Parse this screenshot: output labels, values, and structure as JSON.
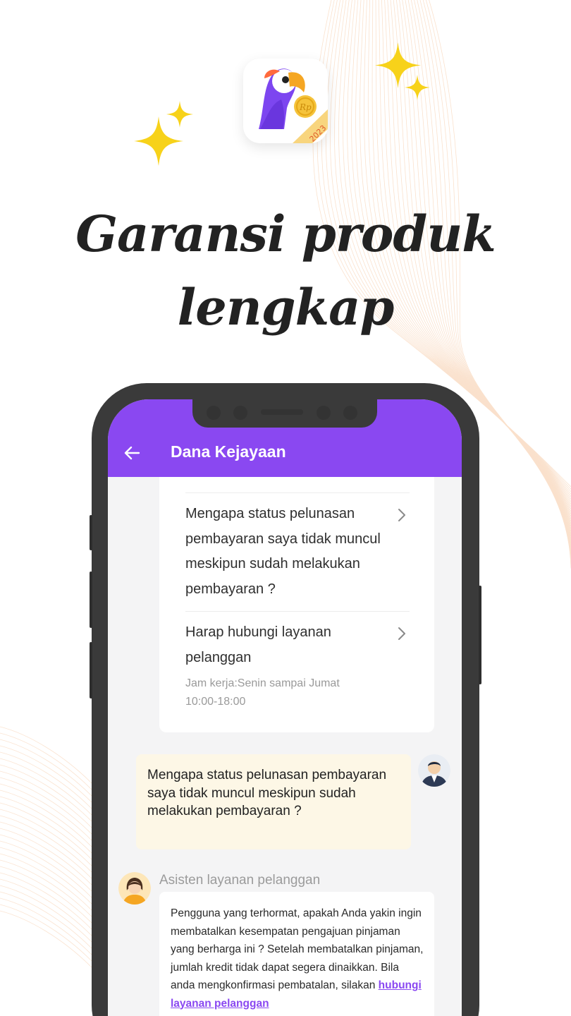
{
  "headline": {
    "line1": "Garansi produk",
    "line2": "lengkap"
  },
  "app_icon": {
    "year": "2023",
    "coin_text": "Rp"
  },
  "appbar": {
    "title": "Dana Kejayaan",
    "back_icon": "arrow-left-icon",
    "color": "#8a48f1"
  },
  "faq": {
    "items": [
      {
        "text": "Mengapa status pelunasan pembayaran saya tidak muncul meskipun sudah melakukan pembayaran ?",
        "icon": "chevron-right-icon"
      },
      {
        "text": "Harap hubungi layanan pelanggan",
        "subtext": "Jam kerja:Senin sampai Jumat 10:00-18:00",
        "icon": "chevron-right-icon"
      }
    ]
  },
  "chat": {
    "user_message": "Mengapa status pelunasan pembayaran saya tidak muncul meskipun sudah melakukan pembayaran ?",
    "agent_name": "Asisten layanan pelanggan",
    "agent_message": "Pengguna yang terhormat, apakah Anda yakin ingin membatalkan kesempatan pengajuan pinjaman yang berharga ini ? Setelah membatalkan pinjaman, jumlah kredit tidak dapat segera dinaikkan. Bila anda mengkonfirmasi pembatalan, silakan ",
    "agent_link": "hubungi layanan pelanggan",
    "user_bubble_color": "#fdf7e6"
  }
}
